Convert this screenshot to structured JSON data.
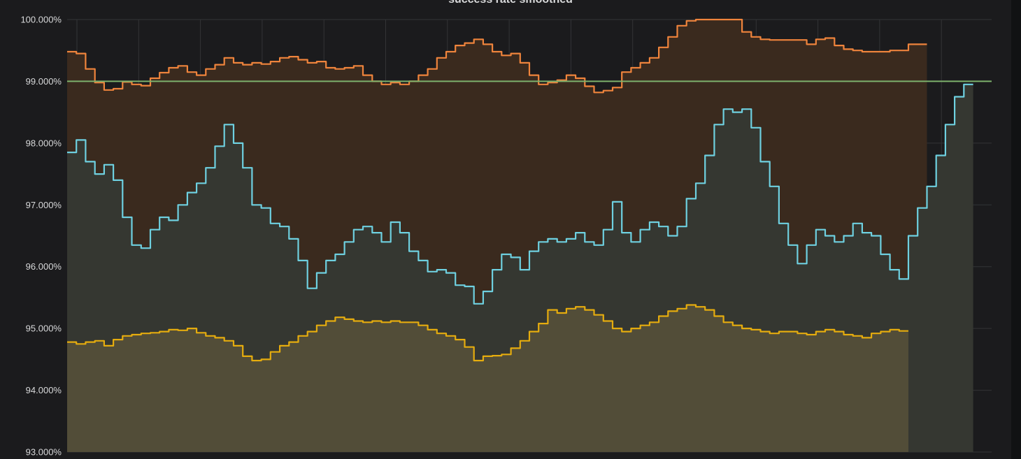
{
  "panel": {
    "title": "success rate smoothed"
  },
  "chart_data": {
    "type": "area",
    "title": "success rate smoothed",
    "xlabel": "",
    "ylabel": "",
    "ylim": [
      93,
      100
    ],
    "x_range": [
      0,
      100
    ],
    "yticks": [
      100,
      99,
      98,
      97,
      96,
      95,
      94,
      93
    ],
    "ytick_labels": [
      "100.000%",
      "99.000%",
      "98.000%",
      "97.000%",
      "96.000%",
      "95.000%",
      "94.000%",
      "93.000%"
    ],
    "grid": true,
    "legend": "none",
    "background": "#1b1b1d",
    "threshold": {
      "value": 99.0,
      "color": "#7eb26d"
    },
    "series": [
      {
        "color": "#ef843c",
        "fill": "#3a2a1e",
        "points": [
          [
            0,
            99.48
          ],
          [
            1,
            99.45
          ],
          [
            2,
            99.2
          ],
          [
            3,
            98.98
          ],
          [
            4,
            98.86
          ],
          [
            5,
            98.88
          ],
          [
            6,
            98.99
          ],
          [
            7,
            98.95
          ],
          [
            8,
            98.93
          ],
          [
            9,
            99.05
          ],
          [
            10,
            99.14
          ],
          [
            11,
            99.22
          ],
          [
            12,
            99.25
          ],
          [
            13,
            99.15
          ],
          [
            14,
            99.1
          ],
          [
            15,
            99.2
          ],
          [
            16,
            99.27
          ],
          [
            17,
            99.38
          ],
          [
            18,
            99.3
          ],
          [
            19,
            99.27
          ],
          [
            20,
            99.3
          ],
          [
            21,
            99.28
          ],
          [
            22,
            99.32
          ],
          [
            23,
            99.38
          ],
          [
            24,
            99.4
          ],
          [
            25,
            99.35
          ],
          [
            26,
            99.3
          ],
          [
            27,
            99.32
          ],
          [
            28,
            99.22
          ],
          [
            29,
            99.2
          ],
          [
            30,
            99.22
          ],
          [
            31,
            99.25
          ],
          [
            32,
            99.1
          ],
          [
            33,
            99.0
          ],
          [
            34,
            98.95
          ],
          [
            35,
            98.98
          ],
          [
            36,
            98.95
          ],
          [
            37,
            99.0
          ],
          [
            38,
            99.1
          ],
          [
            39,
            99.2
          ],
          [
            40,
            99.38
          ],
          [
            41,
            99.48
          ],
          [
            42,
            99.58
          ],
          [
            43,
            99.62
          ],
          [
            44,
            99.68
          ],
          [
            45,
            99.6
          ],
          [
            46,
            99.48
          ],
          [
            47,
            99.42
          ],
          [
            48,
            99.45
          ],
          [
            49,
            99.3
          ],
          [
            50,
            99.1
          ],
          [
            51,
            98.95
          ],
          [
            52,
            98.98
          ],
          [
            53,
            99.02
          ],
          [
            54,
            99.1
          ],
          [
            55,
            99.05
          ],
          [
            56,
            98.92
          ],
          [
            57,
            98.82
          ],
          [
            58,
            98.85
          ],
          [
            59,
            98.9
          ],
          [
            60,
            99.15
          ],
          [
            61,
            99.22
          ],
          [
            62,
            99.3
          ],
          [
            63,
            99.38
          ],
          [
            64,
            99.55
          ],
          [
            65,
            99.72
          ],
          [
            66,
            99.9
          ],
          [
            67,
            99.98
          ],
          [
            68,
            100.0
          ],
          [
            69,
            100.0
          ],
          [
            70,
            100.0
          ],
          [
            71,
            100.0
          ],
          [
            72,
            100.0
          ],
          [
            73,
            99.8
          ],
          [
            74,
            99.72
          ],
          [
            75,
            99.68
          ],
          [
            76,
            99.67
          ],
          [
            77,
            99.67
          ],
          [
            78,
            99.67
          ],
          [
            79,
            99.67
          ],
          [
            80,
            99.6
          ],
          [
            81,
            99.68
          ],
          [
            82,
            99.7
          ],
          [
            83,
            99.58
          ],
          [
            84,
            99.52
          ],
          [
            85,
            99.5
          ],
          [
            86,
            99.48
          ],
          [
            87,
            99.48
          ],
          [
            88,
            99.48
          ],
          [
            89,
            99.5
          ],
          [
            90,
            99.5
          ],
          [
            91,
            99.6
          ],
          [
            92,
            99.6
          ]
        ]
      },
      {
        "color": "#6ed0e0",
        "fill": "#353731",
        "points": [
          [
            0,
            97.85
          ],
          [
            1,
            98.05
          ],
          [
            2,
            97.7
          ],
          [
            3,
            97.5
          ],
          [
            4,
            97.65
          ],
          [
            5,
            97.4
          ],
          [
            6,
            96.8
          ],
          [
            7,
            96.35
          ],
          [
            8,
            96.3
          ],
          [
            9,
            96.6
          ],
          [
            10,
            96.8
          ],
          [
            11,
            96.75
          ],
          [
            12,
            97.0
          ],
          [
            13,
            97.2
          ],
          [
            14,
            97.35
          ],
          [
            15,
            97.6
          ],
          [
            16,
            97.95
          ],
          [
            17,
            98.3
          ],
          [
            18,
            98.0
          ],
          [
            19,
            97.6
          ],
          [
            20,
            97.0
          ],
          [
            21,
            96.95
          ],
          [
            22,
            96.7
          ],
          [
            23,
            96.65
          ],
          [
            24,
            96.45
          ],
          [
            25,
            96.1
          ],
          [
            26,
            95.65
          ],
          [
            27,
            95.9
          ],
          [
            28,
            96.1
          ],
          [
            29,
            96.2
          ],
          [
            30,
            96.4
          ],
          [
            31,
            96.6
          ],
          [
            32,
            96.65
          ],
          [
            33,
            96.55
          ],
          [
            34,
            96.4
          ],
          [
            35,
            96.72
          ],
          [
            36,
            96.55
          ],
          [
            37,
            96.25
          ],
          [
            38,
            96.1
          ],
          [
            39,
            95.92
          ],
          [
            40,
            95.95
          ],
          [
            41,
            95.9
          ],
          [
            42,
            95.7
          ],
          [
            43,
            95.68
          ],
          [
            44,
            95.4
          ],
          [
            45,
            95.6
          ],
          [
            46,
            95.95
          ],
          [
            47,
            96.2
          ],
          [
            48,
            96.15
          ],
          [
            49,
            95.95
          ],
          [
            50,
            96.25
          ],
          [
            51,
            96.4
          ],
          [
            52,
            96.45
          ],
          [
            53,
            96.4
          ],
          [
            54,
            96.45
          ],
          [
            55,
            96.55
          ],
          [
            56,
            96.4
          ],
          [
            57,
            96.35
          ],
          [
            58,
            96.6
          ],
          [
            59,
            97.05
          ],
          [
            60,
            96.55
          ],
          [
            61,
            96.4
          ],
          [
            62,
            96.6
          ],
          [
            63,
            96.72
          ],
          [
            64,
            96.65
          ],
          [
            65,
            96.5
          ],
          [
            66,
            96.65
          ],
          [
            67,
            97.1
          ],
          [
            68,
            97.35
          ],
          [
            69,
            97.8
          ],
          [
            70,
            98.3
          ],
          [
            71,
            98.55
          ],
          [
            72,
            98.5
          ],
          [
            73,
            98.55
          ],
          [
            74,
            98.25
          ],
          [
            75,
            97.7
          ],
          [
            76,
            97.3
          ],
          [
            77,
            96.7
          ],
          [
            78,
            96.35
          ],
          [
            79,
            96.05
          ],
          [
            80,
            96.35
          ],
          [
            81,
            96.6
          ],
          [
            82,
            96.5
          ],
          [
            83,
            96.4
          ],
          [
            84,
            96.5
          ],
          [
            85,
            96.7
          ],
          [
            86,
            96.55
          ],
          [
            87,
            96.5
          ],
          [
            88,
            96.2
          ],
          [
            89,
            95.95
          ],
          [
            90,
            95.8
          ],
          [
            91,
            96.5
          ],
          [
            92,
            96.95
          ],
          [
            93,
            97.3
          ],
          [
            94,
            97.8
          ],
          [
            95,
            98.3
          ],
          [
            96,
            98.75
          ],
          [
            97,
            98.95
          ]
        ]
      },
      {
        "color": "#e5ac0e",
        "fill": "#524d38",
        "points": [
          [
            0,
            94.78
          ],
          [
            1,
            94.75
          ],
          [
            2,
            94.78
          ],
          [
            3,
            94.8
          ],
          [
            4,
            94.72
          ],
          [
            5,
            94.82
          ],
          [
            6,
            94.88
          ],
          [
            7,
            94.9
          ],
          [
            8,
            94.92
          ],
          [
            9,
            94.93
          ],
          [
            10,
            94.95
          ],
          [
            11,
            94.98
          ],
          [
            12,
            94.97
          ],
          [
            13,
            95.0
          ],
          [
            14,
            94.93
          ],
          [
            15,
            94.88
          ],
          [
            16,
            94.85
          ],
          [
            17,
            94.8
          ],
          [
            18,
            94.72
          ],
          [
            19,
            94.55
          ],
          [
            20,
            94.48
          ],
          [
            21,
            94.5
          ],
          [
            22,
            94.62
          ],
          [
            23,
            94.72
          ],
          [
            24,
            94.78
          ],
          [
            25,
            94.88
          ],
          [
            26,
            94.95
          ],
          [
            27,
            95.05
          ],
          [
            28,
            95.12
          ],
          [
            29,
            95.18
          ],
          [
            30,
            95.15
          ],
          [
            31,
            95.12
          ],
          [
            32,
            95.1
          ],
          [
            33,
            95.12
          ],
          [
            34,
            95.1
          ],
          [
            35,
            95.12
          ],
          [
            36,
            95.1
          ],
          [
            37,
            95.1
          ],
          [
            38,
            95.05
          ],
          [
            39,
            94.98
          ],
          [
            40,
            94.92
          ],
          [
            41,
            94.88
          ],
          [
            42,
            94.82
          ],
          [
            43,
            94.7
          ],
          [
            44,
            94.48
          ],
          [
            45,
            94.55
          ],
          [
            46,
            94.56
          ],
          [
            47,
            94.58
          ],
          [
            48,
            94.68
          ],
          [
            49,
            94.8
          ],
          [
            50,
            94.95
          ],
          [
            51,
            95.08
          ],
          [
            52,
            95.3
          ],
          [
            53,
            95.25
          ],
          [
            54,
            95.32
          ],
          [
            55,
            95.35
          ],
          [
            56,
            95.3
          ],
          [
            57,
            95.22
          ],
          [
            58,
            95.12
          ],
          [
            59,
            95.0
          ],
          [
            60,
            94.95
          ],
          [
            61,
            95.0
          ],
          [
            62,
            95.05
          ],
          [
            63,
            95.1
          ],
          [
            64,
            95.2
          ],
          [
            65,
            95.28
          ],
          [
            66,
            95.32
          ],
          [
            67,
            95.38
          ],
          [
            68,
            95.35
          ],
          [
            69,
            95.3
          ],
          [
            70,
            95.2
          ],
          [
            71,
            95.1
          ],
          [
            72,
            95.05
          ],
          [
            73,
            95.0
          ],
          [
            74,
            94.98
          ],
          [
            75,
            94.95
          ],
          [
            76,
            94.92
          ],
          [
            77,
            94.95
          ],
          [
            78,
            94.95
          ],
          [
            79,
            94.92
          ],
          [
            80,
            94.9
          ],
          [
            81,
            94.95
          ],
          [
            82,
            94.98
          ],
          [
            83,
            94.95
          ],
          [
            84,
            94.9
          ],
          [
            85,
            94.88
          ],
          [
            86,
            94.85
          ],
          [
            87,
            94.92
          ],
          [
            88,
            94.95
          ],
          [
            89,
            94.98
          ],
          [
            90,
            94.96
          ]
        ]
      }
    ]
  }
}
